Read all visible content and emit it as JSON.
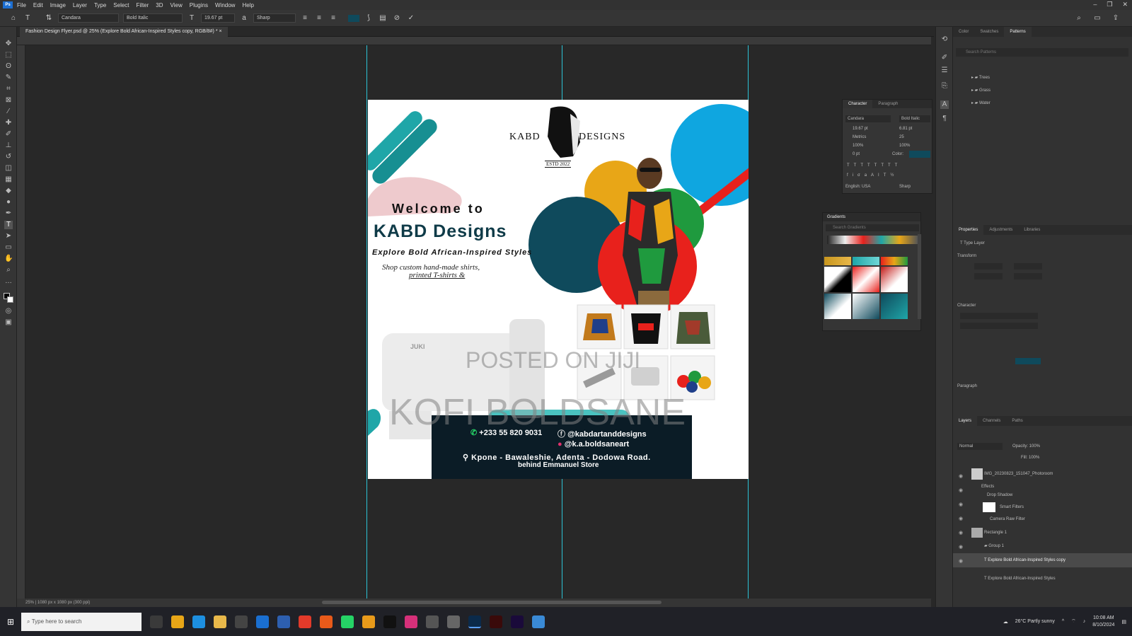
{
  "app": {
    "menu": [
      "File",
      "Edit",
      "Image",
      "Layer",
      "Type",
      "Select",
      "Filter",
      "3D",
      "View",
      "Plugins",
      "Window",
      "Help"
    ],
    "document_tab": "Fashion Design Flyer.psd @ 25% (Explore Bold African-Inspired Styles copy, RGB/8#) *",
    "status": "25% | 1080 px x 1080 px (300 ppi)"
  },
  "options_bar": {
    "font_family": "Candara",
    "font_style": "Bold Italic",
    "font_size": "19.67 pt",
    "antialias": "Sharp"
  },
  "flyer": {
    "brand_left": "KABD",
    "brand_right": "DESIGNS",
    "brand_est": "ESTD 2022",
    "welcome": "Welcome to",
    "title": "KABD Designs",
    "subtitle": "Explore Bold African-Inspired Styles",
    "tagline_1": "Shop custom hand-made shirts,",
    "tagline_2": "printed T-shirts &",
    "phone": "+233 55 820 9031",
    "social_1": "@kabdartanddesigns",
    "social_2": "@k.a.boldsaneart",
    "address_1": "Kpone - Bawaleshie, Adenta - Dodowa Road.",
    "address_2": "behind Emmanuel Store",
    "sewing_brand": "JUKI",
    "watermark_1": "POSTED ON JIJI",
    "watermark_2": "KOFI BOLDSANE"
  },
  "panels": {
    "top_tabs": [
      "Color",
      "Swatches",
      "Patterns"
    ],
    "pattern_search": "Search Patterns",
    "pattern_groups": [
      "Trees",
      "Grass",
      "Water"
    ],
    "character_tabs": [
      "Character",
      "Paragraph"
    ],
    "char_font": "Candara",
    "char_style": "Bold Italic",
    "char_size": "19.67 pt",
    "char_leading": "6.81 pt",
    "char_tracking": "Metrics",
    "char_kern": "25",
    "char_scale_v": "100%",
    "char_scale_h": "100%",
    "char_baseline": "0 pt",
    "char_color_label": "Color:",
    "char_lang": "English: USA",
    "char_aa": "Sharp",
    "gradients_title": "Gradients",
    "gradients_search": "Search Gradients",
    "properties_tabs": [
      "Properties",
      "Adjustments",
      "Libraries"
    ],
    "properties_layer": "Type Layer",
    "properties_transform": "Transform",
    "properties_character": "Character",
    "properties_paragraph": "Paragraph",
    "layers_tabs": [
      "Layers",
      "Channels",
      "Paths"
    ],
    "layers_mode": "Normal",
    "layers_opacity": "Opacity: 100%",
    "layers_fill": "Fill: 100%",
    "layers": [
      "IMG_20230823_151047_Photoroom",
      "Effects",
      "Drop Shadow",
      "Smart Filters",
      "Camera Raw Filter",
      "Rectangle 1",
      "Group 1",
      "Explore Bold African-Inspired Styles copy",
      "Explore Bold African-Inspired Styles"
    ]
  },
  "taskbar": {
    "search_placeholder": "Type here to search",
    "weather": "26°C Partly sunny",
    "time": "10:08 AM",
    "date": "8/10/2024"
  },
  "colors": {
    "teal": "#1fa6a8",
    "navy": "#0f4a5c",
    "sky": "#0fa6e0",
    "red": "#e8211c",
    "green": "#1f9a3e",
    "gold": "#e8a617",
    "guide": "#2bc3d6",
    "pink": "#e8b8bc"
  }
}
